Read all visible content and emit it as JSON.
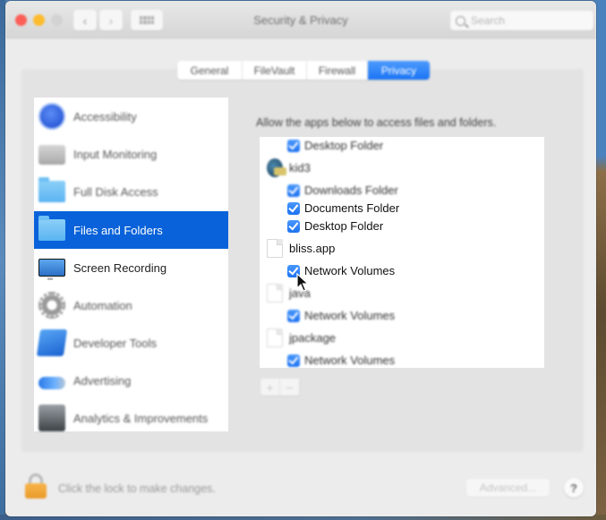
{
  "window": {
    "title": "Security & Privacy",
    "search_placeholder": "Search",
    "nav": {
      "back": "‹",
      "forward": "›"
    }
  },
  "tabs": [
    {
      "label": "General",
      "selected": false
    },
    {
      "label": "FileVault",
      "selected": false
    },
    {
      "label": "Firewall",
      "selected": false
    },
    {
      "label": "Privacy",
      "selected": true
    }
  ],
  "sidebar": {
    "items": [
      {
        "label": "Accessibility",
        "icon": "accessibility-icon"
      },
      {
        "label": "Input Monitoring",
        "icon": "keyboard-icon"
      },
      {
        "label": "Full Disk Access",
        "icon": "folder-icon"
      },
      {
        "label": "Files and Folders",
        "icon": "folder-icon",
        "selected": true
      },
      {
        "label": "Screen Recording",
        "icon": "display-icon"
      },
      {
        "label": "Automation",
        "icon": "gear-icon"
      },
      {
        "label": "Developer Tools",
        "icon": "developer-tools-icon"
      },
      {
        "label": "Advertising",
        "icon": "megaphone-icon"
      },
      {
        "label": "Analytics & Improvements",
        "icon": "analytics-icon"
      }
    ]
  },
  "content": {
    "description": "Allow the apps below to access files and folders.",
    "rows": [
      {
        "type": "permission",
        "label": "Desktop Folder",
        "checked": true
      },
      {
        "type": "app",
        "label": "kid3",
        "icon": "kid3-app-icon"
      },
      {
        "type": "permission",
        "label": "Downloads Folder",
        "checked": true
      },
      {
        "type": "permission",
        "label": "Documents Folder",
        "checked": true
      },
      {
        "type": "permission",
        "label": "Desktop Folder",
        "checked": true
      },
      {
        "type": "app",
        "label": "bliss.app",
        "icon": "document-icon"
      },
      {
        "type": "permission",
        "label": "Network Volumes",
        "checked": true
      },
      {
        "type": "app",
        "label": "java",
        "icon": "document-icon"
      },
      {
        "type": "permission",
        "label": "Network Volumes",
        "checked": true
      },
      {
        "type": "app",
        "label": "jpackage",
        "icon": "document-icon"
      },
      {
        "type": "permission",
        "label": "Network Volumes",
        "checked": true
      }
    ],
    "add_label": "+",
    "remove_label": "−"
  },
  "footer": {
    "lock_text": "Click the lock to make changes.",
    "advanced_label": "Advanced...",
    "help_label": "?"
  },
  "colors": {
    "accent": "#0962d9",
    "checkbox": "#1d72f2",
    "lock": "#ea9a2a"
  }
}
